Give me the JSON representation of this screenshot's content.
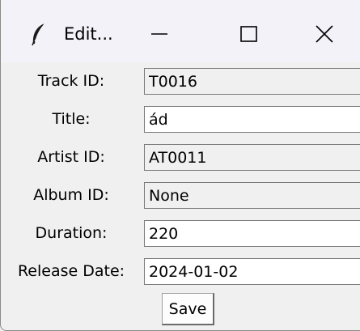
{
  "window": {
    "title": "Edit...",
    "app_icon": "feather-icon",
    "controls": {
      "minimize_icon": "minimize-icon",
      "maximize_icon": "maximize-icon",
      "close_icon": "close-icon"
    }
  },
  "form": {
    "fields": [
      {
        "label": "Track ID:",
        "value": "T0016",
        "editable": false
      },
      {
        "label": "Title:",
        "value": "ád",
        "editable": true
      },
      {
        "label": "Artist ID:",
        "value": "AT0011",
        "editable": false
      },
      {
        "label": "Album ID:",
        "value": "None",
        "editable": false
      },
      {
        "label": "Duration:",
        "value": "220",
        "editable": true
      },
      {
        "label": "Release Date:",
        "value": "2024-01-02",
        "editable": true
      }
    ],
    "save_label": "Save"
  },
  "colors": {
    "titlebar_bg": "#f3f2f8",
    "window_bg": "#f0f0f0",
    "editable_field_bg": "#ffffff",
    "readonly_field_bg": "#f0f0f0"
  }
}
